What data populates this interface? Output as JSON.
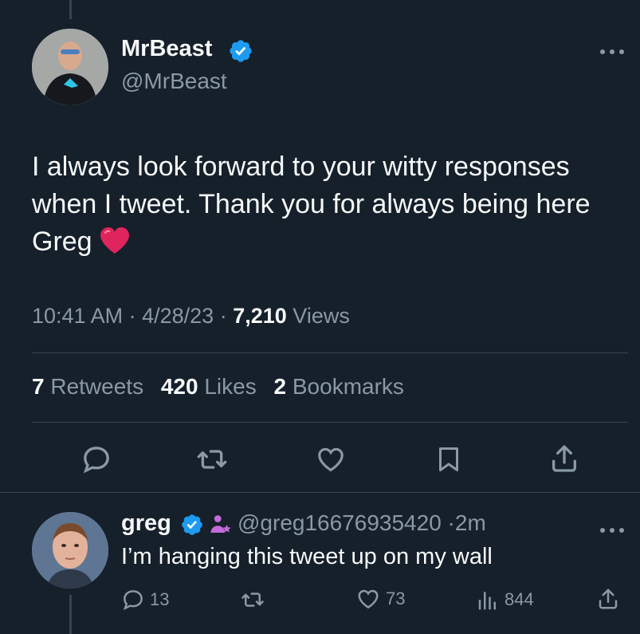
{
  "main_tweet": {
    "author_name": "MrBeast",
    "author_handle": "@MrBeast",
    "text_line1": "I always look forward to your witty responses",
    "text_line2": "when I tweet. Thank you for always being here",
    "text_line3": "Greg",
    "time": "10:41 AM",
    "date": "4/28/23",
    "views_count": "7,210",
    "views_label": "Views",
    "retweets_count": "7",
    "retweets_label": "Retweets",
    "likes_count": "420",
    "likes_label": "Likes",
    "bookmarks_count": "2",
    "bookmarks_label": "Bookmarks"
  },
  "reply": {
    "author_name": "greg",
    "author_handle": "@greg16676935420",
    "age": "2m",
    "text": "I’m hanging this tweet up on my wall",
    "reply_count": "13",
    "like_count": "73",
    "view_count": "844"
  },
  "colors": {
    "background": "#15202b",
    "text": "#f7f9f9",
    "secondary": "#8b98a5",
    "divider": "#38444d",
    "verified": "#1d9bf0",
    "heart": "#e0245e"
  },
  "icons": [
    "verified-badge-icon",
    "more-icon",
    "reply-icon",
    "retweet-icon",
    "like-icon",
    "bookmark-icon",
    "share-icon",
    "affiliate-icon",
    "views-icon",
    "heart-emoji"
  ]
}
